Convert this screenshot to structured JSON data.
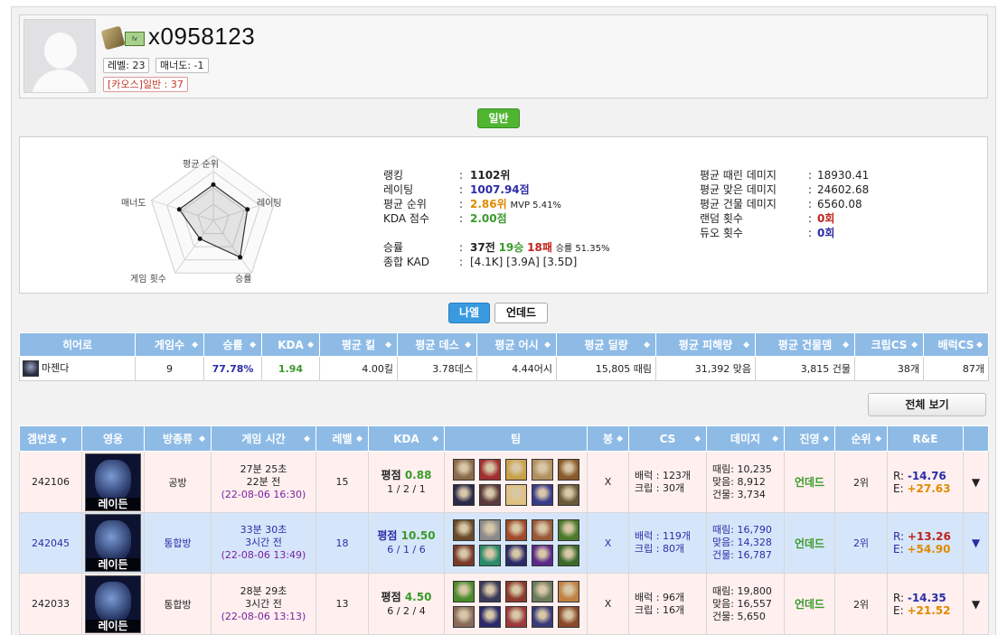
{
  "profile": {
    "username": "x0958123",
    "level_tag": "레벨: 23",
    "manner_tag": "매너도: -1",
    "mode_tag": "[카오스]일반 : 37",
    "card_icon_text": "lv"
  },
  "mode_button": "일반",
  "radar": {
    "labels": {
      "top": "평균 순위",
      "right": "레이팅",
      "bottom_right": "승률",
      "bottom_left": "게임 횟수",
      "left": "매너도"
    },
    "values": {
      "top": 0.55,
      "right": 0.55,
      "bottom_right": 0.7,
      "bottom_left": 0.35,
      "left": 0.55
    }
  },
  "stats_left": {
    "ranking": {
      "label": "랭킹",
      "value": "1102위"
    },
    "rating": {
      "label": "레이팅",
      "value": "1007.94점"
    },
    "avg_rank": {
      "label": "평균 순위",
      "value": "2.86위",
      "mvp": "MVP 5.41%"
    },
    "kda_score": {
      "label": "KDA 점수",
      "value": "2.00점"
    },
    "winrate": {
      "label": "승률",
      "games": "37전",
      "wins": "19승",
      "losses": "18패",
      "pct": "승률 51.35%"
    },
    "kad": {
      "label": "종합 KAD",
      "value": "[4.1K] [3.9A] [3.5D]"
    }
  },
  "stats_right": {
    "dealt": {
      "label": "평균 때린 데미지",
      "value": "18930.41"
    },
    "taken": {
      "label": "평균 맞은 데미지",
      "value": "24602.68"
    },
    "building": {
      "label": "평균 건물 데미지",
      "value": "6560.08"
    },
    "random": {
      "label": "랜덤 횟수",
      "value": "0회"
    },
    "duo": {
      "label": "듀오 횟수",
      "value": "0회"
    }
  },
  "colon": ":",
  "faction_tabs": {
    "active": "나엘",
    "inactive": "언데드"
  },
  "hero_table": {
    "headers": [
      "히어로",
      "게임수",
      "승률",
      "KDA",
      "평균 킬",
      "평균 데스",
      "평균 어시",
      "평균 딜량",
      "평균 피해량",
      "평균 건물뎀",
      "크립CS",
      "배럭CS"
    ],
    "row": {
      "hero": "마젠다",
      "games": "9",
      "winrate": "77.78%",
      "kda": "1.94",
      "kills": "4.00킬",
      "deaths": "3.78데스",
      "assists": "4.44어시",
      "damage": "15,805 때림",
      "taken": "31,392 맞음",
      "building": "3,815 건물",
      "creep_cs": "38개",
      "barrack_cs": "87개"
    }
  },
  "view_all_button": "전체 보기",
  "games_table": {
    "headers": [
      "겜번호",
      "영웅",
      "방종류",
      "게임 시간",
      "레벨",
      "KDA",
      "팀",
      "붕",
      "CS",
      "데미지",
      "진영",
      "순위",
      "R&E"
    ],
    "sort_down": "▼",
    "sort_both": "◆",
    "rows": [
      {
        "id": "242106",
        "hero": "레이든",
        "room": "공방",
        "duration": "27분 25초",
        "ago": "22분 전",
        "datetime": "(22-08-06 16:30)",
        "level": "15",
        "kda_label": "평점",
        "kda_value": "0.88",
        "kda_detail": "1 / 2 / 1",
        "bung": "X",
        "cs_barrack": "배럭 : 123개",
        "cs_creep": "크립 : 30개",
        "dmg_dealt": "때림: 10,235",
        "dmg_taken": "맞음: 8,912",
        "dmg_building": "건물: 3,734",
        "faction": "언데드",
        "rank": "2위",
        "r_label": "R:",
        "r_value": "-14.76",
        "e_label": "E:",
        "e_value": "+27.63",
        "expand": "▼",
        "team_colors": [
          "#8a6a4a",
          "#a03030",
          "#c8a048",
          "#b09060",
          "#8a5a2a",
          "#2a2a4a",
          "#5a3a3a",
          "#e0c080",
          "#3a3a8a",
          "#6a5a3a"
        ]
      },
      {
        "id": "242045",
        "hero": "레이든",
        "room": "통합방",
        "duration": "33분 30초",
        "ago": "3시간 전",
        "datetime": "(22-08-06 13:49)",
        "level": "18",
        "kda_label": "평점",
        "kda_value": "10.50",
        "kda_detail": "6 / 1 / 6",
        "bung": "X",
        "cs_barrack": "배럭 : 119개",
        "cs_creep": "크립 : 80개",
        "dmg_dealt": "때림: 16,790",
        "dmg_taken": "맞음: 14,328",
        "dmg_building": "건물: 16,787",
        "faction": "언데드",
        "rank": "2위",
        "r_label": "R:",
        "r_value": "+13.26",
        "e_label": "E:",
        "e_value": "+54.90",
        "expand": "▼",
        "team_colors": [
          "#6a4a2a",
          "#8a8a8a",
          "#a04a2a",
          "#9a5a3a",
          "#4a7a2a",
          "#7a3a2a",
          "#2a8a6a",
          "#2a2a6a",
          "#5a2a8a",
          "#3a6a2a"
        ]
      },
      {
        "id": "242033",
        "hero": "레이든",
        "room": "통합방",
        "duration": "28분 29초",
        "ago": "3시간 전",
        "datetime": "(22-08-06 13:13)",
        "level": "13",
        "kda_label": "평점",
        "kda_value": "4.50",
        "kda_detail": "6 / 2 / 4",
        "bung": "X",
        "cs_barrack": "배럭 : 96개",
        "cs_creep": "크립 : 16개",
        "dmg_dealt": "때림: 19,800",
        "dmg_taken": "맞음: 16,557",
        "dmg_building": "건물: 5,650",
        "faction": "언데드",
        "rank": "2위",
        "r_label": "R:",
        "r_value": "-14.35",
        "e_label": "E:",
        "e_value": "+21.52",
        "expand": "▼",
        "team_colors": [
          "#4a8a2a",
          "#3a3a5a",
          "#8a3a2a",
          "#6a7a5a",
          "#c08040",
          "#8a6a5a",
          "#2a2a6a",
          "#9a3a3a",
          "#3a3a7a",
          "#8a4a2a"
        ]
      }
    ]
  },
  "colors": {
    "header_blue": "#8ebbe6",
    "green_button": "#4fb531",
    "active_tab": "#3a9ae0",
    "row_pink": "#fff0ef",
    "row_blue": "#d6e6fa",
    "faction_green": "#3a9a2a"
  }
}
